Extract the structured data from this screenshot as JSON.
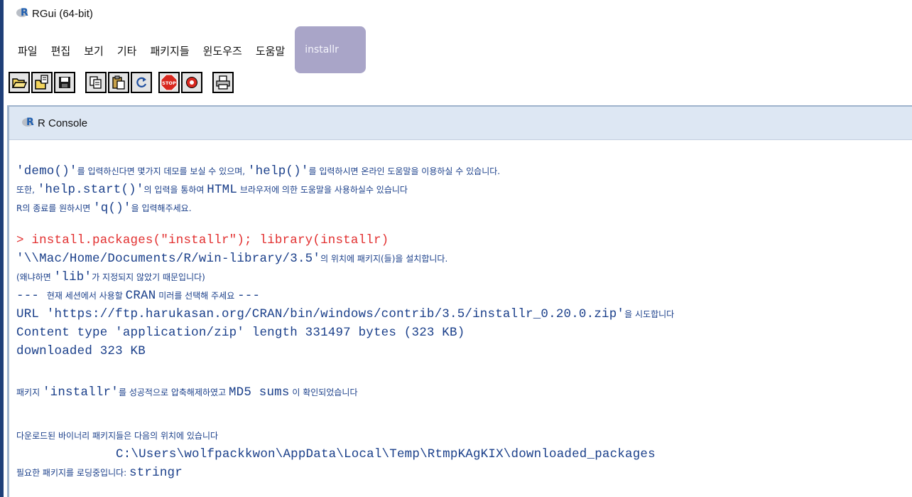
{
  "window": {
    "title": "RGui (64-bit)"
  },
  "menu": {
    "items": [
      "파일",
      "편집",
      "보기",
      "기타",
      "패키지들",
      "윈도우즈",
      "도움말"
    ],
    "installr": "installr"
  },
  "toolbar": {
    "buttons": [
      {
        "name": "open-script-icon"
      },
      {
        "name": "load-workspace-icon"
      },
      {
        "name": "save-icon"
      },
      {
        "name": "copy-icon"
      },
      {
        "name": "paste-icon"
      },
      {
        "name": "refresh-icon"
      },
      {
        "name": "stop-icon",
        "label": "STOP"
      },
      {
        "name": "record-icon"
      },
      {
        "name": "print-icon"
      }
    ]
  },
  "console": {
    "title": "R Console",
    "intro": [
      {
        "a": "'demo()'",
        "b": "를 입력하신다면 몇가지 데모를 보실 수 있으며, ",
        "c": "'help()'",
        "d": "를 입력하시면 온라인 도움말을 이용하실 수 있습니다."
      },
      {
        "a": "또한, ",
        "b": "'help.start()'",
        "c": "의 입력을 통하여 ",
        "d": "HTML",
        "e": " 브라우저에 의한 도움말을 사용하실수 있습니다"
      },
      {
        "a": "R의 종료를 원하시면 ",
        "b": "'q()'",
        "c": "을 입력해주세요."
      }
    ],
    "command": "> install.packages(\"installr\"); library(installr)",
    "output": {
      "l1_code": "'\\\\Mac/Home/Documents/R/win-library/3.5'",
      "l1_ko": "의 위치에 패키지(들)을 설치합니다.",
      "l2_ko1": "(왜냐하면 ",
      "l2_code": "'lib'",
      "l2_ko2": "가 지정되지 않았기 때문입니다)",
      "l3_code1": "--- ",
      "l3_ko1": "현재 세션에서 사용할 ",
      "l3_code2": "CRAN",
      "l3_ko2": " 미러를 선택해 주세요 ",
      "l3_code3": "---",
      "l4_code": "URL 'https://ftp.harukasan.org/CRAN/bin/windows/contrib/3.5/installr_0.20.0.zip'",
      "l4_ko": "을 시도합니다",
      "l5": "Content type 'application/zip' length 331497 bytes (323 KB)",
      "l6": "downloaded 323 KB",
      "l7_ko1": "패키지 ",
      "l7_code1": "'installr'",
      "l7_ko2": "를 성공적으로 압축해제하였고 ",
      "l7_code2": "MD5 sums",
      "l7_ko3": " 이 확인되었습니다",
      "l8_ko": "다운로드된 바이너리 패키지들은 다음의 위치에 있습니다",
      "l9_code": "C:\\Users\\wolfpackkwon\\AppData\\Local\\Temp\\RtmpKAgKIX\\downloaded_packages",
      "l10_ko": "필요한 패키지를 로딩중입니다: ",
      "l10_code": "stringr"
    }
  }
}
